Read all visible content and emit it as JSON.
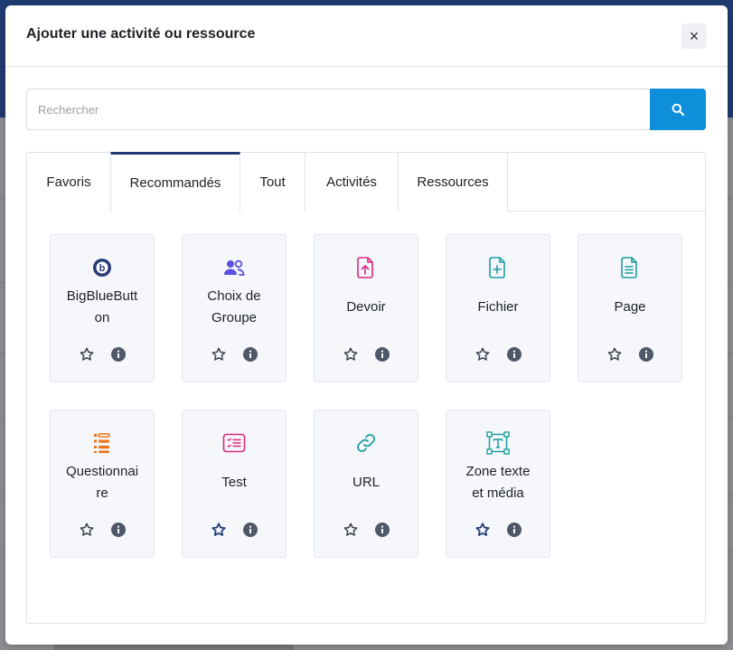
{
  "dialog": {
    "title": "Ajouter une activité ou ressource",
    "close_label": "×"
  },
  "search": {
    "placeholder": "Rechercher",
    "value": ""
  },
  "tabs": [
    {
      "label": "Favoris",
      "active": false
    },
    {
      "label": "Recommandés",
      "active": true
    },
    {
      "label": "Tout",
      "active": false
    },
    {
      "label": "Activités",
      "active": false
    },
    {
      "label": "Ressources",
      "active": false
    }
  ],
  "modules": [
    {
      "label": "BigBlueButton",
      "display": "BigBlueButt\non",
      "icon": "bigbluebutton-icon",
      "color": "#2a3c78",
      "starred": false
    },
    {
      "label": "Choix de Groupe",
      "display": "Choix de\nGroupe",
      "icon": "group-choice-icon",
      "color": "#5b4fe0",
      "starred": false
    },
    {
      "label": "Devoir",
      "display": "Devoir",
      "icon": "assignment-icon",
      "color": "#e0267e",
      "starred": false
    },
    {
      "label": "Fichier",
      "display": "Fichier",
      "icon": "file-icon",
      "color": "#1d9ea0",
      "starred": false
    },
    {
      "label": "Page",
      "display": "Page",
      "icon": "page-icon",
      "color": "#1d9ea0",
      "starred": false
    },
    {
      "label": "Questionnaire",
      "display": "Questionnai\nre",
      "icon": "questionnaire-icon",
      "color": "#e8731b",
      "starred": false
    },
    {
      "label": "Test",
      "display": "Test",
      "icon": "quiz-icon",
      "color": "#e0267e",
      "starred": true
    },
    {
      "label": "URL",
      "display": "URL",
      "icon": "url-icon",
      "color": "#1d9ea0",
      "starred": false
    },
    {
      "label": "Zone texte et média",
      "display": "Zone texte\net média",
      "icon": "text-media-icon",
      "color": "#1d9ea0",
      "starred": true
    }
  ],
  "colors": {
    "accent": "#0f8fd9",
    "brand": "#1f3b73",
    "star_default": "#3a4250",
    "star_active": "#1f3b73",
    "info": "#4f5868"
  }
}
